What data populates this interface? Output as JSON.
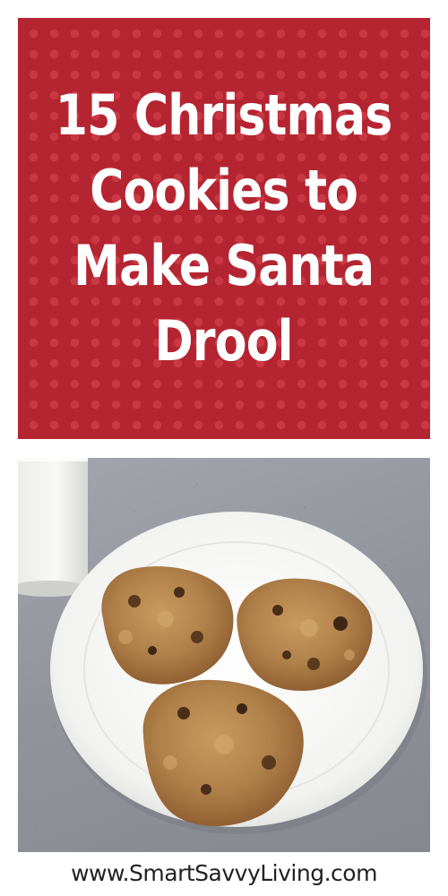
{
  "title_lines": [
    "15 Christmas",
    "Cookies to",
    "Make Santa",
    "Drool"
  ],
  "website": "www.SmartSavvyLiving.com",
  "colors": {
    "panel_red": "#b42531",
    "polka_dot": "#dc4652",
    "title_text": "#ffffff",
    "countertop": "#92959c",
    "plate": "#f6f6f4",
    "cookie": "#b0804a"
  }
}
